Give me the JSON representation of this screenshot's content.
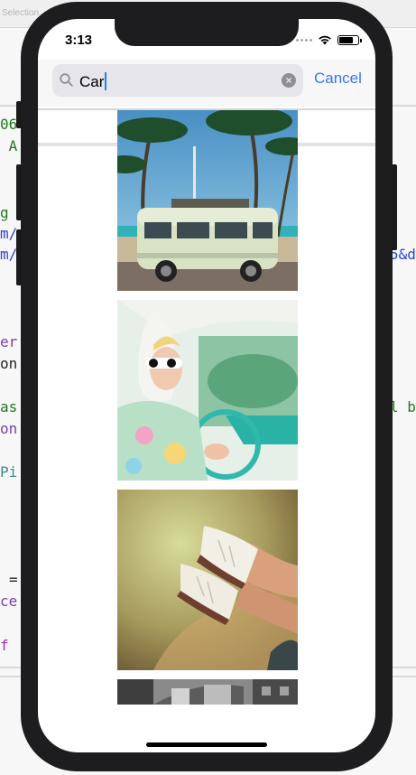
{
  "background_window": {
    "title": "Selection",
    "code_fragments": [
      {
        "text": "06",
        "color": "#1f7a1f"
      },
      {
        "text": " A",
        "color": "#1f7a1f"
      },
      {
        "text": "g",
        "color": "#1f7a1f"
      },
      {
        "text": "m/",
        "color": "#2b43d8"
      },
      {
        "text": "m/",
        "color": "#2b43d8"
      },
      {
        "text": "er",
        "color": "#7a3fb0"
      },
      {
        "text": "on",
        "color": "#222222"
      },
      {
        "text": "as",
        "color": "#1f7a1f"
      },
      {
        "text": "on",
        "color": "#7a3fb0"
      },
      {
        "text": "Pi",
        "color": "#3a8a8a"
      },
      {
        "text": "=",
        "color": "#222222"
      },
      {
        "text": "ce",
        "color": "#7a3fb0"
      },
      {
        "text": "f",
        "color": "#a22ea8"
      },
      {
        "text": "5&d",
        "color": "#2b43d8"
      },
      {
        "text": "l b",
        "color": "#1f7a1f"
      }
    ]
  },
  "status_bar": {
    "time": "3:13",
    "battery_level": 0.85
  },
  "search": {
    "query": "Car",
    "cancel_label": "Cancel"
  },
  "results": [
    {
      "subject": "vintage van under palm trees"
    },
    {
      "subject": "woman in headscarf driving retro car"
    },
    {
      "subject": "legs in white sneakers out of car window"
    },
    {
      "subject": "black and white city street"
    }
  ],
  "colors": {
    "accent": "#3478f6",
    "phone_frame": "#1d1d1f"
  }
}
